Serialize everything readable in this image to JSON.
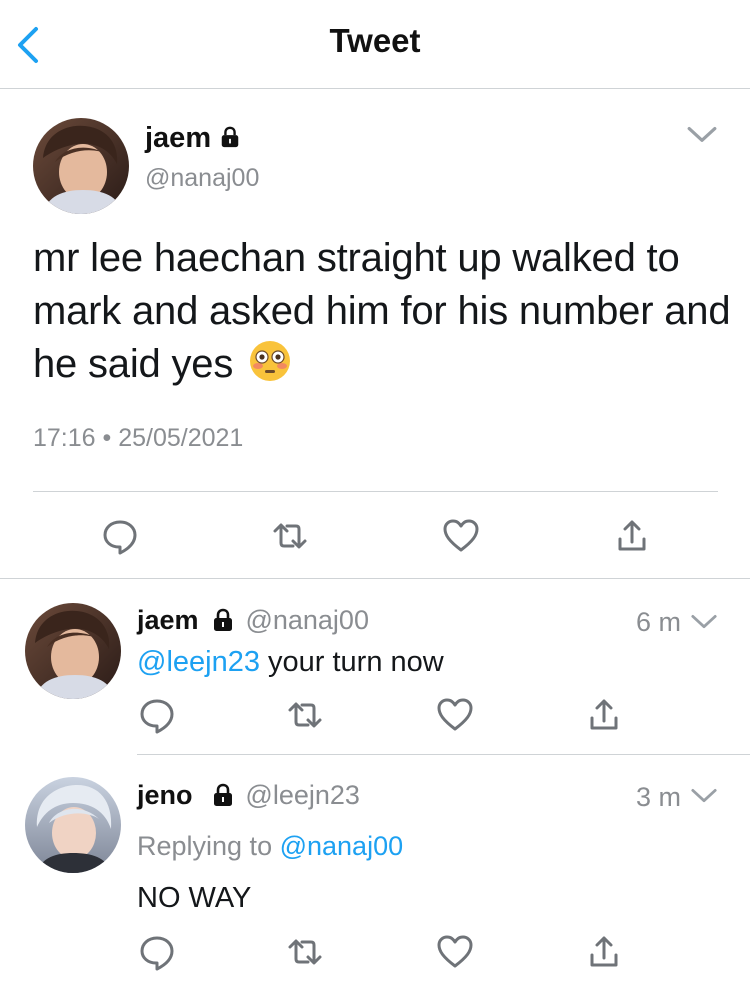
{
  "header": {
    "title": "Tweet",
    "back_icon": "chevron-left-icon"
  },
  "main_tweet": {
    "name": "jaem",
    "handle": "@nanaj00",
    "text": "mr lee haechan straight up walked to mark and asked him for his number and he said yes",
    "emoji": "😳",
    "timestamp": "17:16 • 25/05/2021",
    "actions": [
      "reply-icon",
      "retweet-icon",
      "like-icon",
      "share-icon"
    ]
  },
  "replies": [
    {
      "name": "jaem",
      "handle": "@nanaj00",
      "time": "6 m",
      "mention": "@leejn23",
      "text": " your turn now"
    },
    {
      "name": "jeno",
      "handle": "@leejn23",
      "time": "3 m",
      "replying_prefix": "Replying to ",
      "replying_to": "@nanaj00",
      "text": "NO WAY"
    }
  ],
  "colors": {
    "accent": "#1da1f2",
    "muted": "#8a8d91",
    "text": "#14171a",
    "divider": "#cfd3d6"
  }
}
